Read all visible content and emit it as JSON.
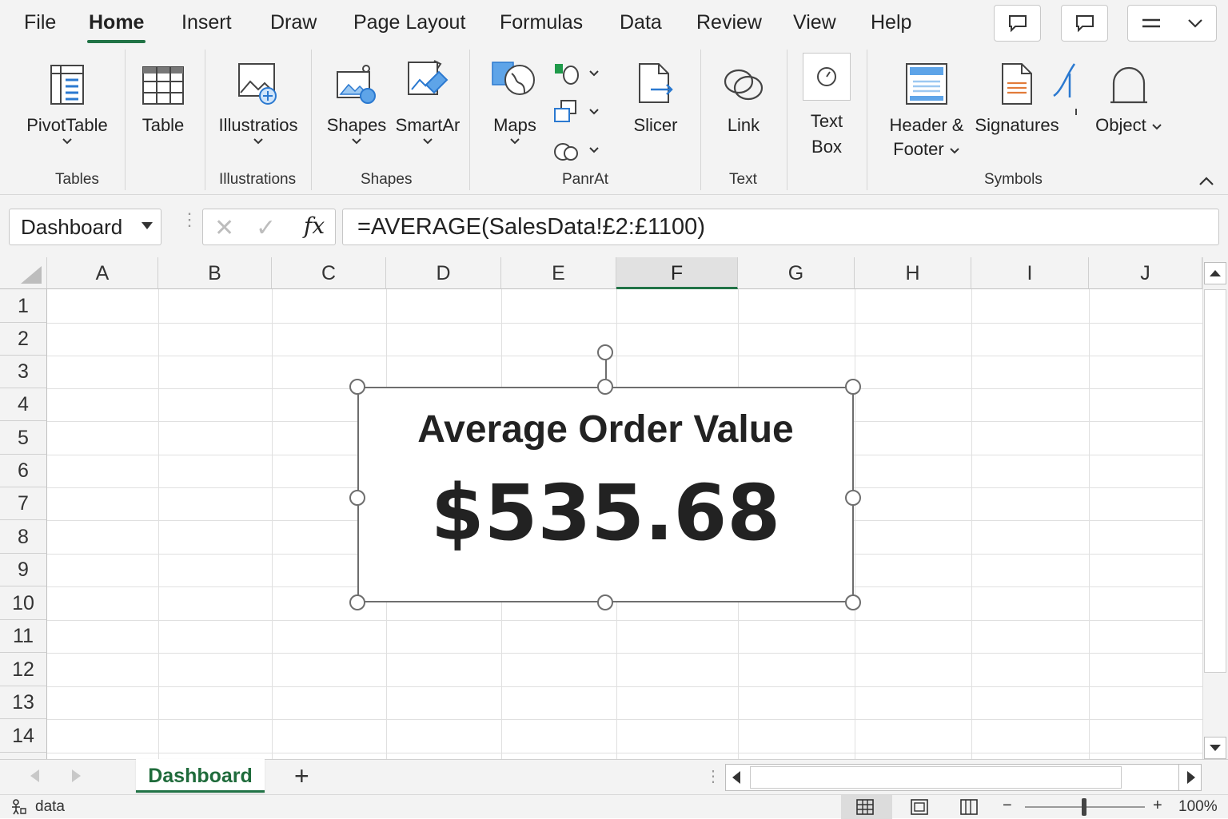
{
  "menu": {
    "tabs": [
      "File",
      "Home",
      "Insert",
      "Draw",
      "Page Layout",
      "Formulas",
      "Data",
      "Review",
      "View",
      "Help"
    ],
    "active_tab": "Home"
  },
  "ribbon": {
    "pivottable": "PivotTable",
    "table": "Table",
    "illustrations": "Illustratios",
    "shapes": "Shapes",
    "smartart": "SmartAr",
    "maps": "Maps",
    "slicer": "Slicer",
    "link": "Link",
    "textbox_line1": "Text",
    "textbox_line2": "Box",
    "header_line1": "Header &",
    "header_line2": "Footer",
    "signatures": "Signatures",
    "object": "Object",
    "groups": {
      "tables": "Tables",
      "illustrations": "Illustrations",
      "shapes": "Shapes",
      "panrat": "PanrAt",
      "text": "Text",
      "symbols": "Symbols"
    }
  },
  "formula_bar": {
    "name_box": "Dashboard",
    "formula": "=AVERAGE(SalesData!£2:£1100)"
  },
  "grid": {
    "columns": [
      "A",
      "B",
      "C",
      "D",
      "E",
      "F",
      "G",
      "H",
      "I",
      "J"
    ],
    "selected_column": "F",
    "rows": [
      "1",
      "2",
      "3",
      "4",
      "5",
      "6",
      "7",
      "8",
      "9",
      "10",
      "11",
      "12",
      "13",
      "14"
    ]
  },
  "textbox": {
    "title": "Average Order Value",
    "value": "$535.68"
  },
  "sheet_tabs": {
    "active": "Dashboard",
    "add_label": "+"
  },
  "status": {
    "text": "data",
    "zoom": "100%"
  },
  "colors": {
    "accent": "#217346",
    "ribbon_bg": "#f3f3f3"
  }
}
